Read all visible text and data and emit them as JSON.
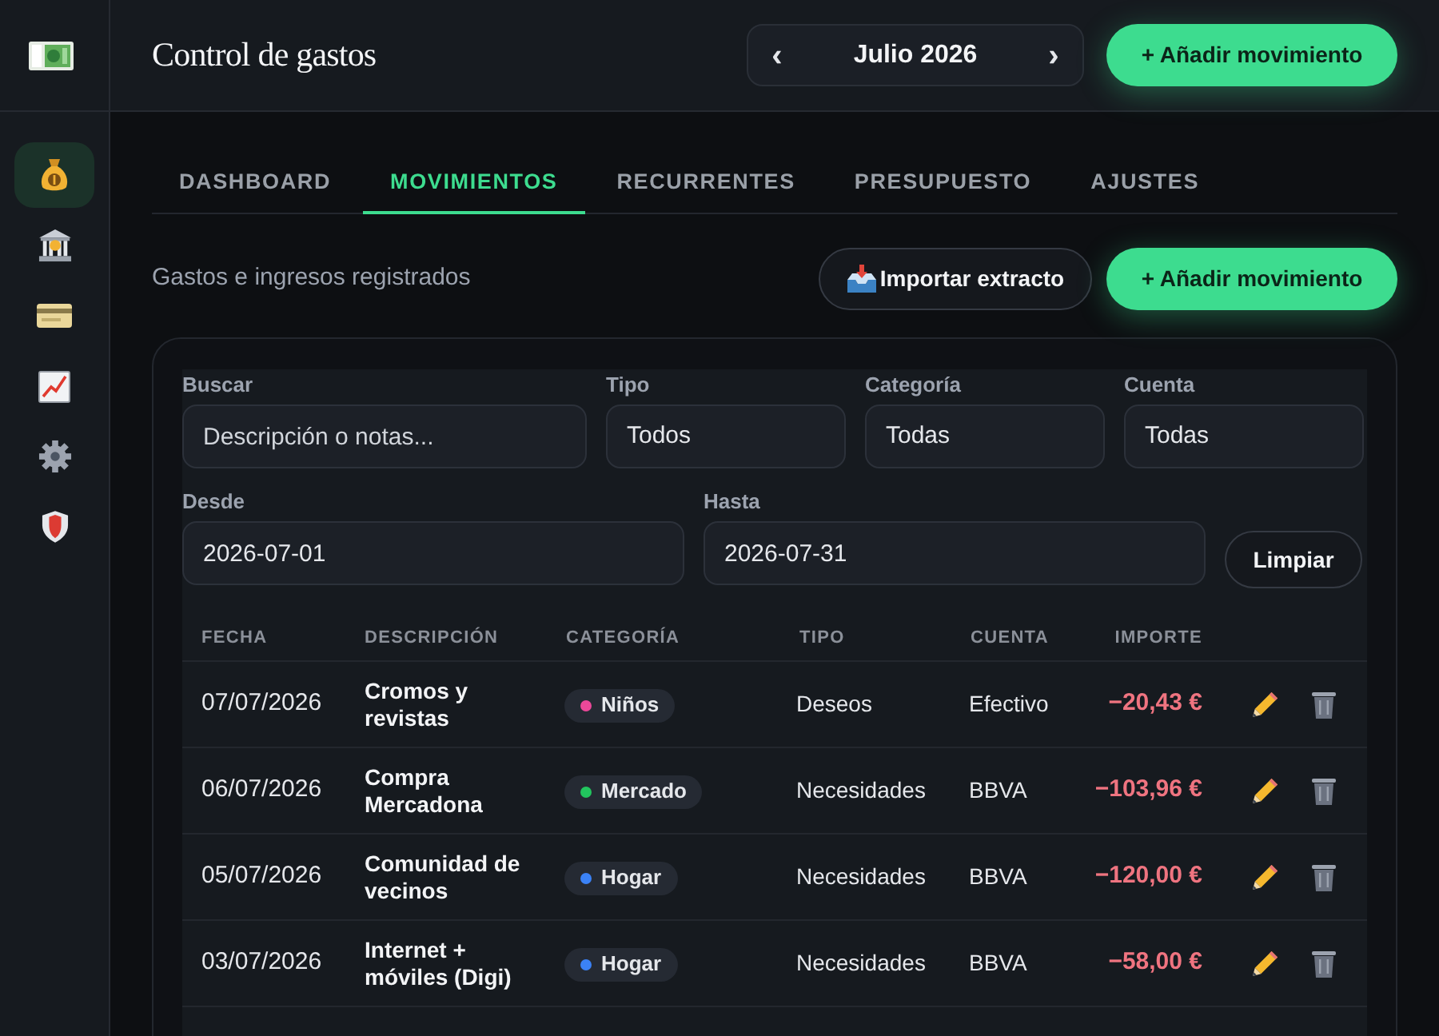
{
  "sidebar": {
    "items": [
      {
        "selected": true
      },
      {
        "selected": false
      },
      {
        "selected": false
      },
      {
        "selected": false
      },
      {
        "selected": false
      },
      {
        "selected": false
      }
    ]
  },
  "header": {
    "title": "Control de gastos",
    "month_nav": {
      "prev": "‹",
      "label": "Julio 2026",
      "next": "›"
    },
    "add_button": "+ Añadir movimiento"
  },
  "tabs": [
    {
      "label": "DASHBOARD",
      "selected": false
    },
    {
      "label": "MOVIMIENTOS",
      "selected": true
    },
    {
      "label": "RECURRENTES",
      "selected": false
    },
    {
      "label": "PRESUPUESTO",
      "selected": false
    },
    {
      "label": "AJUSTES",
      "selected": false
    }
  ],
  "toolbar": {
    "subtitle": "Gastos e ingresos registrados",
    "import_button": "Importar extracto",
    "add_button": "+ Añadir movimiento"
  },
  "filters": {
    "search": {
      "label": "Buscar",
      "placeholder": "Descripción o notas..."
    },
    "type": {
      "label": "Tipo",
      "value": "Todos"
    },
    "category": {
      "label": "Categoría",
      "value": "Todas"
    },
    "account": {
      "label": "Cuenta",
      "value": "Todas"
    },
    "from": {
      "label": "Desde",
      "value": "2026-07-01"
    },
    "to": {
      "label": "Hasta",
      "value": "2026-07-31"
    },
    "clear_button": "Limpiar"
  },
  "table": {
    "columns": [
      "FECHA",
      "DESCRIPCIÓN",
      "CATEGORÍA",
      "TIPO",
      "CUENTA",
      "IMPORTE"
    ],
    "rows": [
      {
        "date": "07/07/2026",
        "description": "Cromos y revistas",
        "category": {
          "label": "Niños",
          "color": "#ec4899"
        },
        "type": "Deseos",
        "account": "Efectivo",
        "amount": "−20,43 €"
      },
      {
        "date": "06/07/2026",
        "description": "Compra Mercadona",
        "category": {
          "label": "Mercado",
          "color": "#22c55e"
        },
        "type": "Necesidades",
        "account": "BBVA",
        "amount": "−103,96 €"
      },
      {
        "date": "05/07/2026",
        "description": "Comunidad de vecinos",
        "category": {
          "label": "Hogar",
          "color": "#3b82f6"
        },
        "type": "Necesidades",
        "account": "BBVA",
        "amount": "−120,00 €"
      },
      {
        "date": "03/07/2026",
        "description": "Internet + móviles (Digi)",
        "category": {
          "label": "Hogar",
          "color": "#3b82f6"
        },
        "type": "Necesidades",
        "account": "BBVA",
        "amount": "−58,00 €"
      }
    ]
  }
}
